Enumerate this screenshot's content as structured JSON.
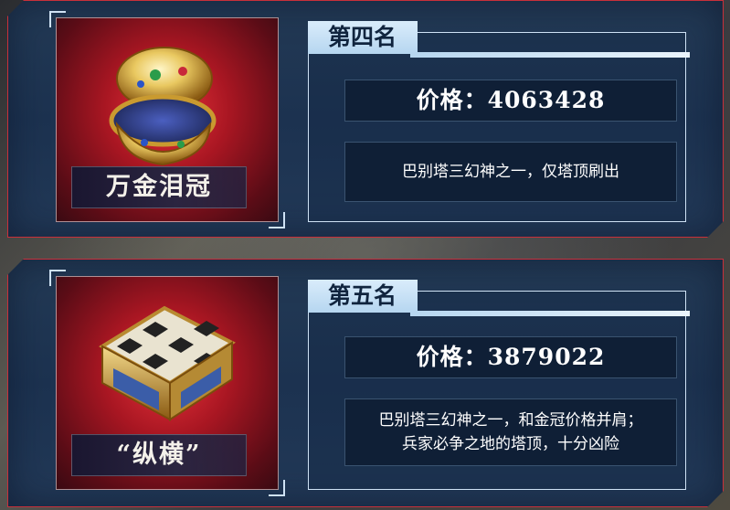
{
  "items": [
    {
      "rank": "第四名",
      "name": "万金泪冠",
      "icon": "golden-egg-crown-icon",
      "price_label": "价格：",
      "price_value": "4063428",
      "description_lines": [
        "巴别塔三幻神之一，仅塔顶刷出"
      ]
    },
    {
      "rank": "第五名",
      "name": "“纵横”",
      "icon": "golden-chessboard-icon",
      "price_label": "价格：",
      "price_value": "3879022",
      "description_lines": [
        "巴别塔三幻神之一，和金冠价格并肩；",
        "兵家必争之地的塔顶，十分凶险"
      ]
    }
  ],
  "colors": {
    "card_border": "#c8303a",
    "item_bg": "#a81622",
    "tab_bg": "#d9ecfb",
    "box_bg": "#0f1f36"
  }
}
